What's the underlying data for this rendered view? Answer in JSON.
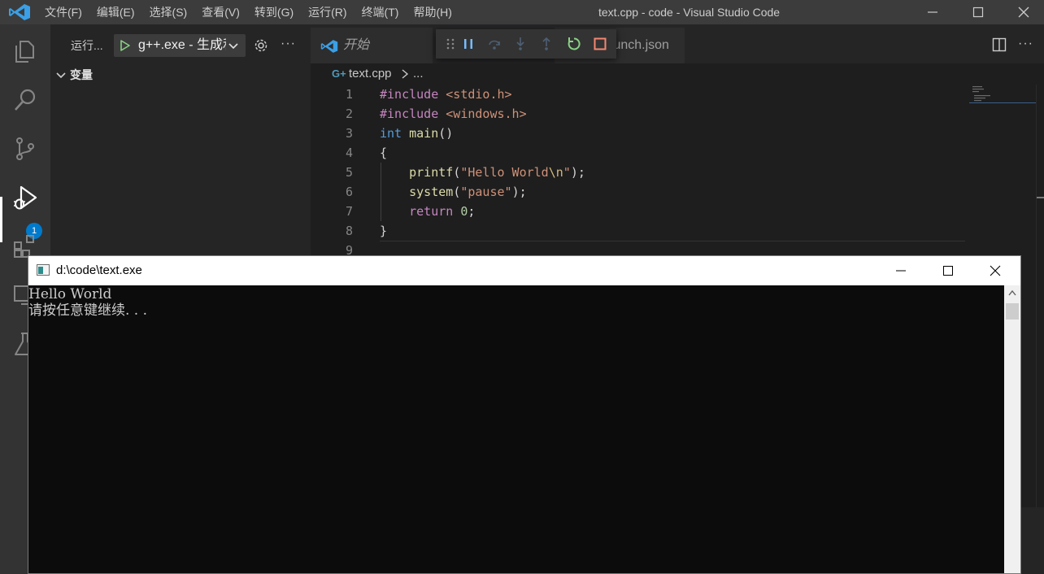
{
  "titlebar": {
    "menu": [
      "文件(F)",
      "编辑(E)",
      "选择(S)",
      "查看(V)",
      "转到(G)",
      "运行(R)",
      "终端(T)",
      "帮助(H)"
    ],
    "window_title": "text.cpp - code - Visual Studio Code"
  },
  "activity": {
    "icons": [
      "explorer-icon",
      "search-icon",
      "source-control-icon",
      "run-debug-icon",
      "extensions-icon",
      "remote-explorer-icon",
      "testing-icon"
    ],
    "debug_badge": "1"
  },
  "sidebar": {
    "run_label": "运行...",
    "config_name": "g++.exe - 生成和调试活动文件",
    "variables_label": "变量"
  },
  "tabs": {
    "welcome": "开始",
    "launch": "launch.json"
  },
  "breadcrumb": {
    "file": "text.cpp",
    "more": "..."
  },
  "editor": {
    "line_numbers": [
      "1",
      "2",
      "3",
      "4",
      "5",
      "6",
      "7",
      "8",
      "9"
    ],
    "code": [
      [
        {
          "t": "dir",
          "v": "#include"
        },
        {
          "t": "txt",
          "v": " "
        },
        {
          "t": "inc",
          "v": "<stdio.h>"
        }
      ],
      [
        {
          "t": "dir",
          "v": "#include"
        },
        {
          "t": "txt",
          "v": " "
        },
        {
          "t": "inc",
          "v": "<windows.h>"
        }
      ],
      [
        {
          "t": "kw",
          "v": "int"
        },
        {
          "t": "txt",
          "v": " "
        },
        {
          "t": "fn",
          "v": "main"
        },
        {
          "t": "txt",
          "v": "()"
        }
      ],
      [
        {
          "t": "txt",
          "v": "{"
        }
      ],
      [
        {
          "t": "txt",
          "v": "    "
        },
        {
          "t": "fn",
          "v": "printf"
        },
        {
          "t": "txt",
          "v": "("
        },
        {
          "t": "str",
          "v": "\"Hello World"
        },
        {
          "t": "esc",
          "v": "\\n"
        },
        {
          "t": "str",
          "v": "\""
        },
        {
          "t": "txt",
          "v": ");"
        }
      ],
      [
        {
          "t": "txt",
          "v": "    "
        },
        {
          "t": "fn",
          "v": "system"
        },
        {
          "t": "txt",
          "v": "("
        },
        {
          "t": "str",
          "v": "\"pause\""
        },
        {
          "t": "txt",
          "v": ");"
        }
      ],
      [
        {
          "t": "txt",
          "v": "    "
        },
        {
          "t": "ctl",
          "v": "return"
        },
        {
          "t": "txt",
          "v": " "
        },
        {
          "t": "num",
          "v": "0"
        },
        {
          "t": "txt",
          "v": ";"
        }
      ],
      [
        {
          "t": "txt",
          "v": "}"
        }
      ],
      [
        {
          "t": "txt",
          "v": ""
        }
      ]
    ]
  },
  "console": {
    "title": "d:\\code\\text.exe",
    "lines": [
      "Hello World",
      "请按任意键继续. . ."
    ]
  },
  "colors": {
    "accent": "#007acc",
    "titlebar_bg": "#3c3c3c",
    "editor_bg": "#1e1e1e",
    "console_bg": "#0c0c0c"
  }
}
